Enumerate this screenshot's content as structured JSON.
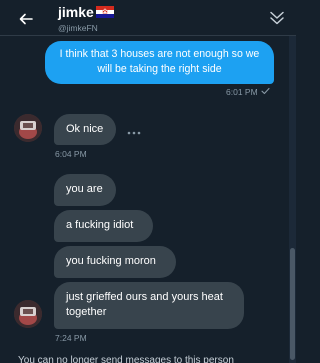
{
  "header": {
    "display_name": "jimke",
    "handle": "@jimkeFN",
    "flag_icon": "croatia-flag",
    "back_icon": "back-arrow-icon",
    "collapse_icon": "double-chevron-down-icon"
  },
  "messages": {
    "sent_1": {
      "text": "I think that 3 houses are not enough so we will be taking the right side",
      "time": "6:01 PM",
      "status_icon": "checkmark-icon"
    },
    "received_1": {
      "text": "Ok nice",
      "time": "6:04 PM",
      "more_icon": "more-dots-icon"
    },
    "received_2": {
      "text": "you are"
    },
    "received_3": {
      "text": "a fucking idiot"
    },
    "received_4": {
      "text": "you fucking moron"
    },
    "received_5": {
      "text": "just grieffed ours and yours heat together",
      "time": "7:24 PM"
    }
  },
  "colors": {
    "background": "#15202b",
    "sent_bubble": "#1da1f2",
    "received_bubble": "#38444d",
    "muted_text": "#8899a6"
  },
  "footer": {
    "partial_text": "You can no longer send messages to this person"
  }
}
